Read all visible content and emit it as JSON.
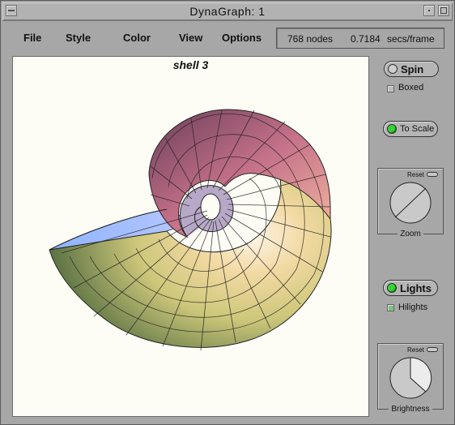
{
  "window": {
    "title": "DynaGraph: 1"
  },
  "menu": {
    "items": [
      {
        "label": "File"
      },
      {
        "label": "Style"
      },
      {
        "label": "Color"
      },
      {
        "label": "View"
      },
      {
        "label": "Options"
      }
    ],
    "status": {
      "nodes": "768 nodes",
      "time": "0.7184",
      "unit": "secs/frame"
    }
  },
  "canvas": {
    "title": "shell 3"
  },
  "controls": {
    "spin": {
      "label": "Spin",
      "on": false
    },
    "boxed": {
      "label": "Boxed",
      "checked": false
    },
    "to_scale": {
      "label": "To Scale",
      "on": true
    },
    "zoom": {
      "reset_label": "Reset",
      "caption": "Zoom"
    },
    "lights": {
      "label": "Lights",
      "on": true
    },
    "hilights": {
      "label": "Hilights",
      "checked": true
    },
    "brightness": {
      "reset_label": "Reset",
      "caption": "Brightness"
    }
  },
  "colors": {
    "led_on": "#32d632",
    "window_bg": "#a7a7a7",
    "canvas_bg": "#fdfdf6"
  }
}
